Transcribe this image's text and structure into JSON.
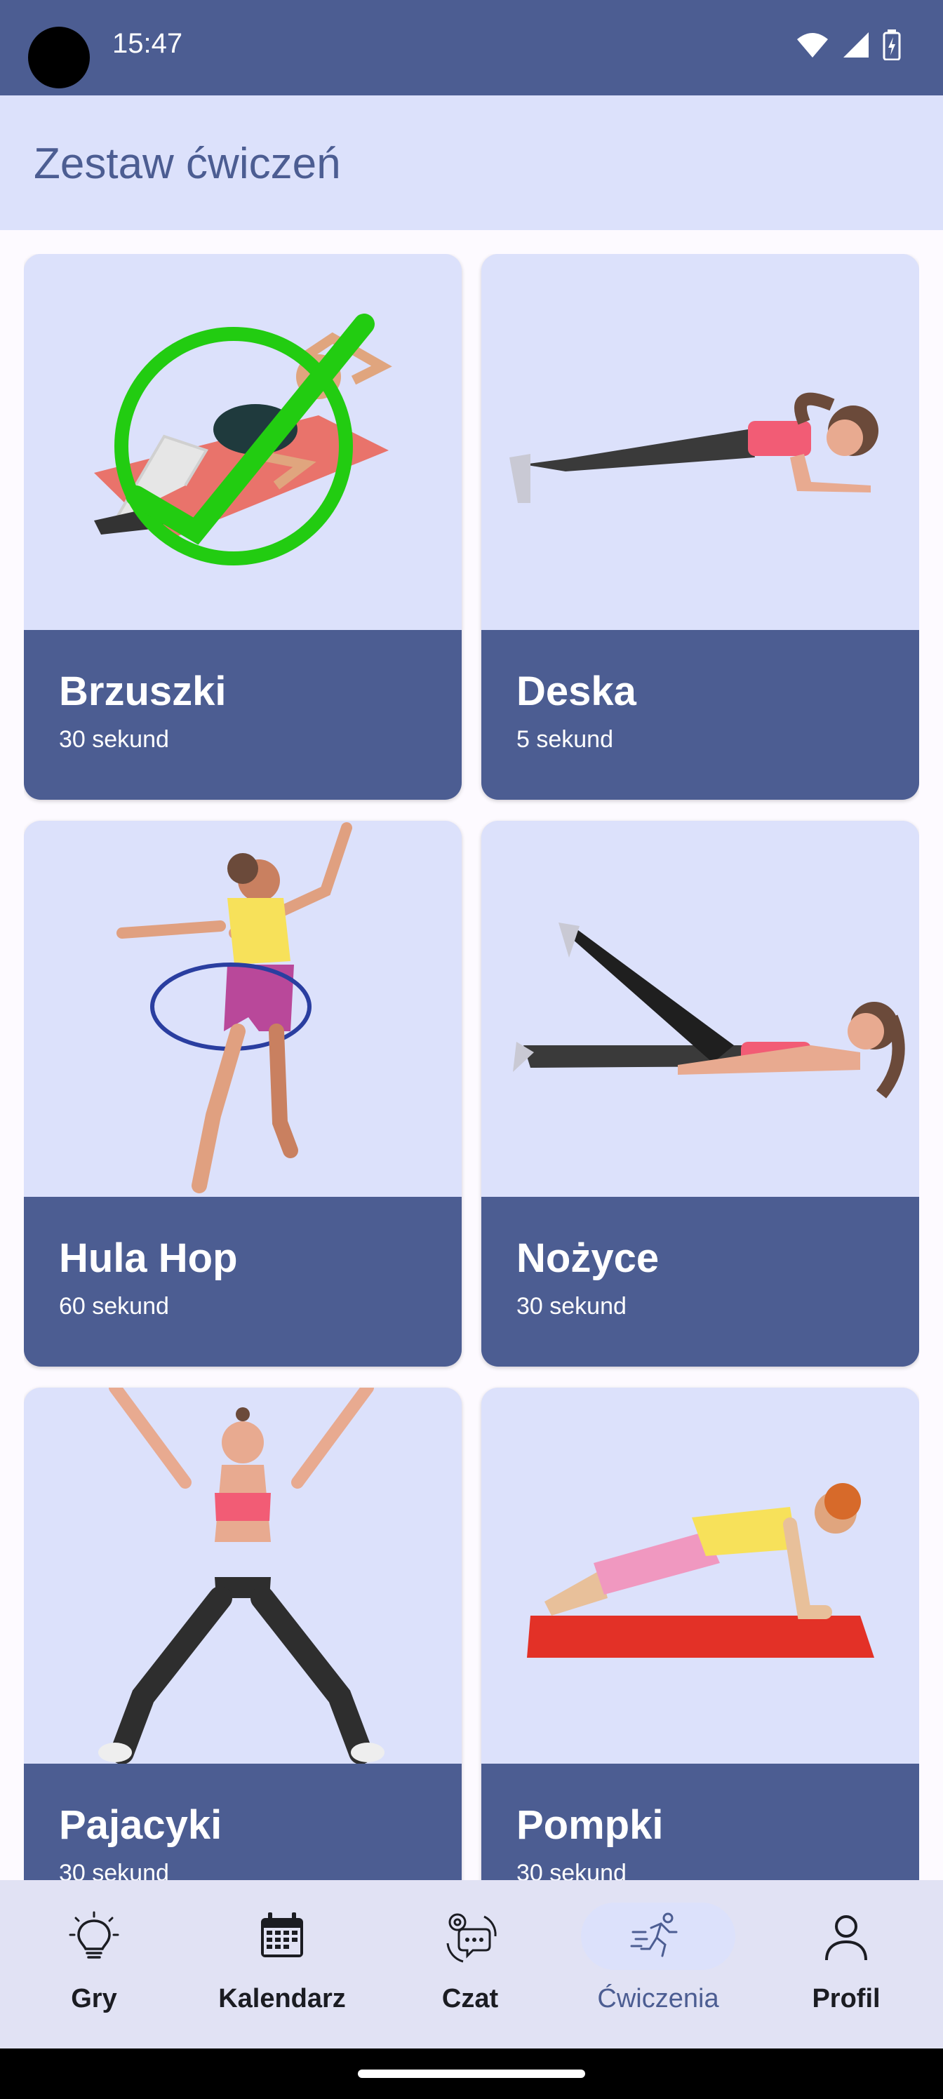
{
  "status": {
    "time": "15:47"
  },
  "app_bar": {
    "title": "Zestaw ćwiczeń"
  },
  "exercises": [
    {
      "name": "Brzuszki",
      "duration": "30 sekund",
      "completed": true
    },
    {
      "name": "Deska",
      "duration": "5 sekund",
      "completed": false
    },
    {
      "name": "Hula Hop",
      "duration": "60 sekund",
      "completed": false
    },
    {
      "name": "Nożyce",
      "duration": "30 sekund",
      "completed": false
    },
    {
      "name": "Pajacyki",
      "duration": "30 sekund",
      "completed": false
    },
    {
      "name": "Pompki",
      "duration": "30 sekund",
      "completed": false
    }
  ],
  "nav": [
    {
      "label": "Gry",
      "icon": "lightbulb-icon"
    },
    {
      "label": "Kalendarz",
      "icon": "calendar-icon"
    },
    {
      "label": "Czat",
      "icon": "chat-icon"
    },
    {
      "label": "Ćwiczenia",
      "icon": "running-icon",
      "active": true
    },
    {
      "label": "Profil",
      "icon": "person-icon"
    }
  ],
  "colors": {
    "primary": "#4c5d92",
    "surface": "#dce1fb",
    "check": "#22cc11"
  }
}
